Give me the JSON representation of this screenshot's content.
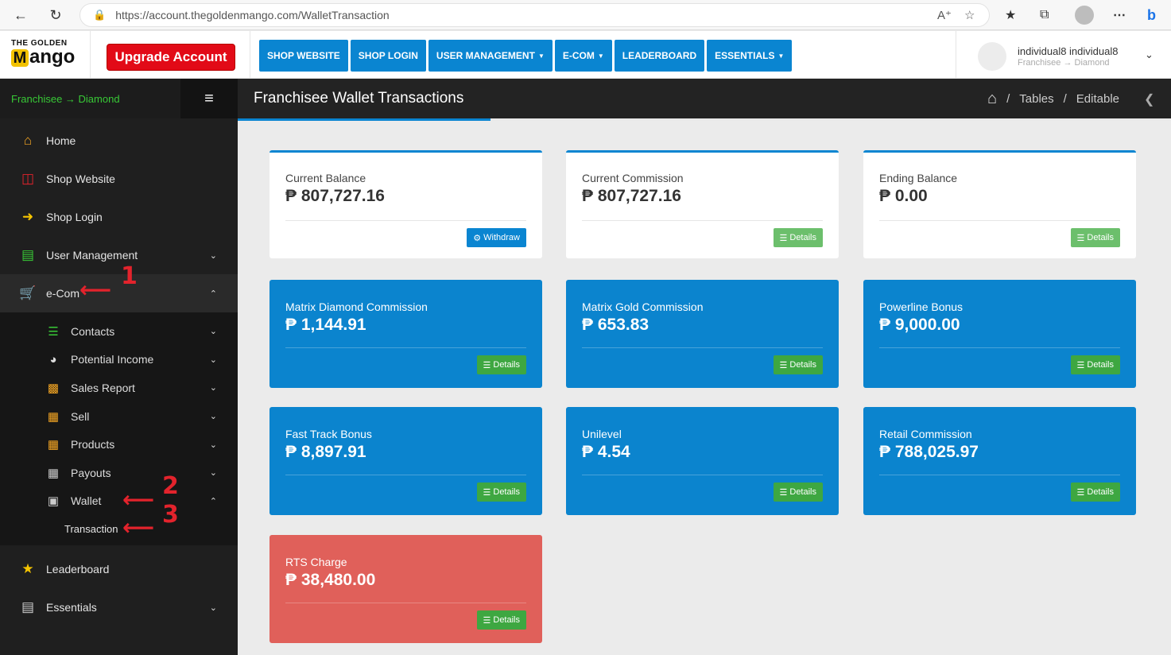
{
  "browser": {
    "url": "https://account.thegoldenmango.com/WalletTransaction"
  },
  "header": {
    "logo_top": "THE GOLDEN",
    "logo_bottom": "ango",
    "logo_m": "M",
    "upgrade_label": "Upgrade Account",
    "nav": [
      {
        "label": "SHOP WEBSITE",
        "dropdown": false
      },
      {
        "label": "SHOP LOGIN",
        "dropdown": false
      },
      {
        "label": "USER MANAGEMENT",
        "dropdown": true
      },
      {
        "label": "E-COM",
        "dropdown": true
      },
      {
        "label": "LEADERBOARD",
        "dropdown": false
      },
      {
        "label": "ESSENTIALS",
        "dropdown": true
      }
    ],
    "user_name": "individual8 individual8",
    "user_role": "Franchisee → Diamond"
  },
  "sidebar": {
    "role": "Franchisee → Diamond",
    "items": [
      {
        "label": "Home",
        "icon": "home-icon"
      },
      {
        "label": "Shop Website",
        "icon": "store-icon"
      },
      {
        "label": "Shop Login",
        "icon": "sign-in-icon"
      },
      {
        "label": "User Management",
        "icon": "id-card-icon"
      },
      {
        "label": "e-Com",
        "icon": "cart-icon"
      }
    ],
    "ecom_sub": [
      {
        "label": "Contacts",
        "icon": "sitemap-icon"
      },
      {
        "label": "Potential Income",
        "icon": "gauge-icon"
      },
      {
        "label": "Sales Report",
        "icon": "bar-chart-icon"
      },
      {
        "label": "Sell",
        "icon": "register-icon"
      },
      {
        "label": "Products",
        "icon": "grid-icon"
      },
      {
        "label": "Payouts",
        "icon": "calculator-icon"
      },
      {
        "label": "Wallet",
        "icon": "wallet-icon"
      }
    ],
    "wallet_sub": "Transaction",
    "bottom": [
      {
        "label": "Leaderboard",
        "icon": "trophy-icon"
      },
      {
        "label": "Essentials",
        "icon": "document-icon"
      }
    ]
  },
  "annotations": [
    "1",
    "2",
    "3"
  ],
  "page": {
    "title": "Franchisee Wallet Transactions",
    "breadcrumb": [
      "Tables",
      "Editable"
    ],
    "breadcrumb_sep": "/"
  },
  "cards": [
    {
      "label": "Current Balance",
      "value": "₱ 807,727.16",
      "button": "Withdraw"
    },
    {
      "label": "Current Commission",
      "value": "₱ 807,727.16",
      "button": "Details"
    },
    {
      "label": "Ending Balance",
      "value": "₱ 0.00",
      "button": "Details"
    },
    {
      "label": "Matrix Diamond Commission",
      "value": "₱ 1,144.91",
      "button": "Details"
    },
    {
      "label": "Matrix Gold Commission",
      "value": "₱ 653.83",
      "button": "Details"
    },
    {
      "label": "Powerline Bonus",
      "value": "₱ 9,000.00",
      "button": "Details"
    },
    {
      "label": "Fast Track Bonus",
      "value": "₱ 8,897.91",
      "button": "Details"
    },
    {
      "label": "Unilevel",
      "value": "₱ 4.54",
      "button": "Details"
    },
    {
      "label": "Retail Commission",
      "value": "₱ 788,025.97",
      "button": "Details"
    },
    {
      "label": "RTS Charge",
      "value": "₱ 38,480.00",
      "button": "Details"
    }
  ],
  "colors": {
    "primary": "#0a85d1",
    "success": "#3ea741",
    "danger": "#e0605a",
    "sidebar_role": "#38c936",
    "upgrade": "#e20a17"
  }
}
